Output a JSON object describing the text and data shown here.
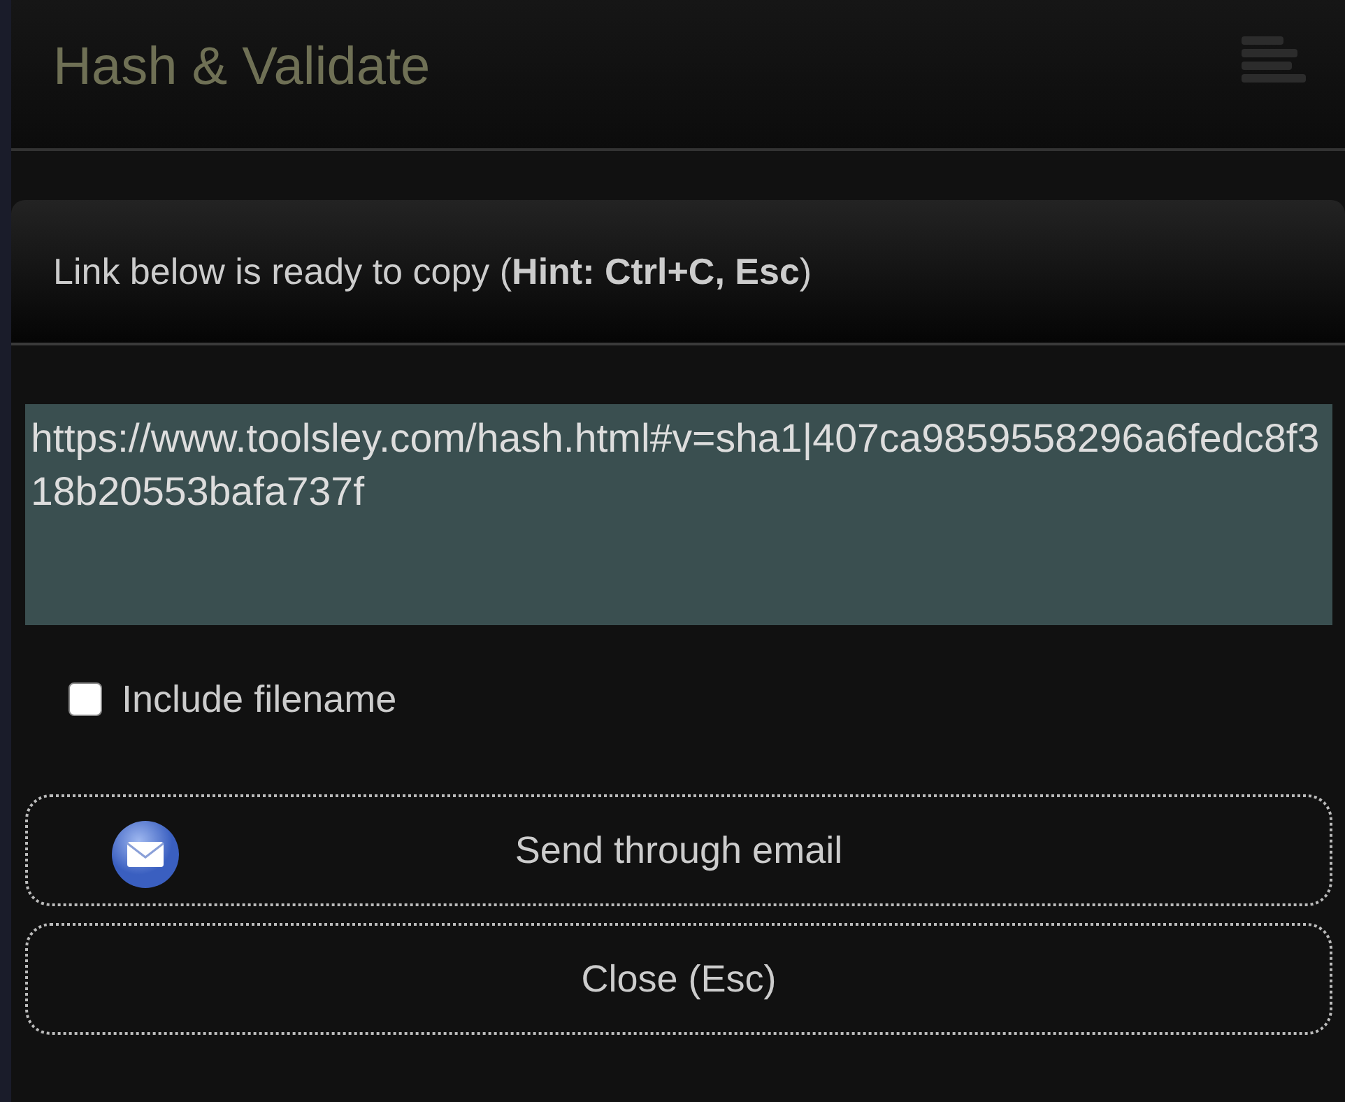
{
  "app_header": {
    "title": "Hash & Validate"
  },
  "dialog": {
    "heading": "Link below is ready to copy (**Hint: Ctrl+C, Esc**)",
    "link": "https://www.toolsley.com/hash.html#v=sha1|407ca9859558296a6fedc8f318b20553bafa737f",
    "include_filename": {
      "label": "Include filename",
      "checked": false
    },
    "buttons": [
      {
        "kind": "email",
        "label": "Send through email"
      },
      {
        "kind": "plain",
        "label": "Close (Esc)"
      }
    ]
  }
}
